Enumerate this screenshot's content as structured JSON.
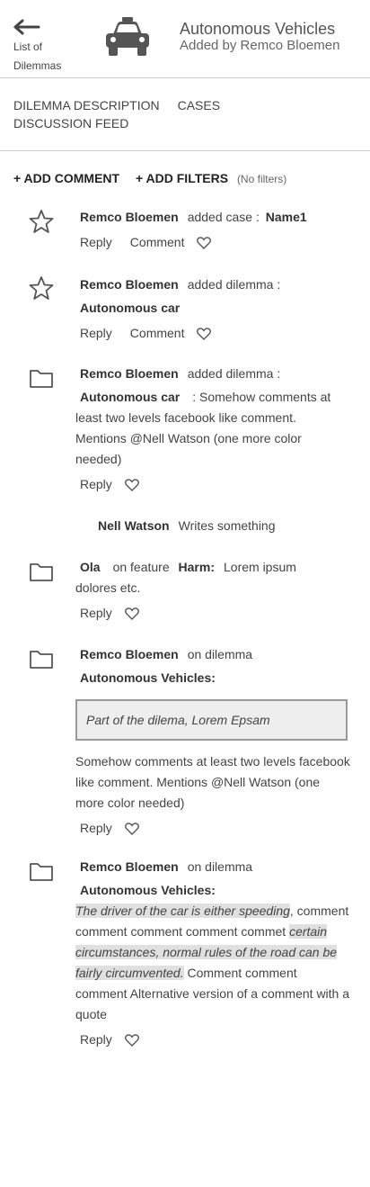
{
  "header": {
    "back_label": "List of Dilemmas",
    "title": "Autonomous Vehicles",
    "subtitle": "Added by Remco Bloemen"
  },
  "tabs": [
    "DILEMMA DESCRIPTION",
    "CASES",
    "DISCUSSION FEED"
  ],
  "actions": {
    "add_comment": "+ ADD COMMENT",
    "add_filters": "+ ADD FILTERS",
    "filters_status": "(No filters)"
  },
  "labels": {
    "reply": "Reply",
    "comment": "Comment"
  },
  "feed": [
    {
      "icon": "star-icon",
      "author": "Remco Bloemen",
      "action": "added case :",
      "target": "Name1"
    },
    {
      "icon": "star-icon",
      "author": "Remco Bloemen",
      "action": "added dilemma :",
      "target": "Autonomous car"
    },
    {
      "icon": "folder-icon",
      "author": "Remco Bloemen",
      "action": "added dilemma :",
      "target": "Autonomous car",
      "text_inline": ": Somehow comments at",
      "text_rest": "least two levels facebook like comment. Mentions @Nell Watson (one more color needed)"
    },
    {
      "nested": true,
      "author": "Nell Watson",
      "text": "Writes something"
    },
    {
      "icon": "folder-icon",
      "author": "Ola",
      "action": "on feature",
      "target": "Harm:",
      "text_inline": "Lorem ipsum",
      "text_rest": "dolores etc."
    },
    {
      "icon": "folder-icon",
      "author": "Remco Bloemen",
      "action": "on dilemma",
      "target": "Autonomous Vehicles:",
      "quote": "Part of the dilema, Lorem Epsam",
      "text": "Somehow comments at least two levels facebook like comment. Mentions @Nell Watson (one more color needed)"
    },
    {
      "icon": "folder-icon",
      "author": "Remco Bloemen",
      "action": "on dilemma",
      "target": "Autonomous Vehicles:",
      "hl1": "The driver of the car is either speeding",
      "t1": ", comment comment comment comment commet",
      "hl2": "certain circumstances, normal rules of the road can be fairly circumvented.",
      "t2": " Comment comment comment Alternative version of a comment with a quote"
    }
  ],
  "colors": {
    "text": "#333333",
    "divider": "#cccccc",
    "quote_bg": "#eeeeee",
    "highlight": "#e0e0e0"
  }
}
